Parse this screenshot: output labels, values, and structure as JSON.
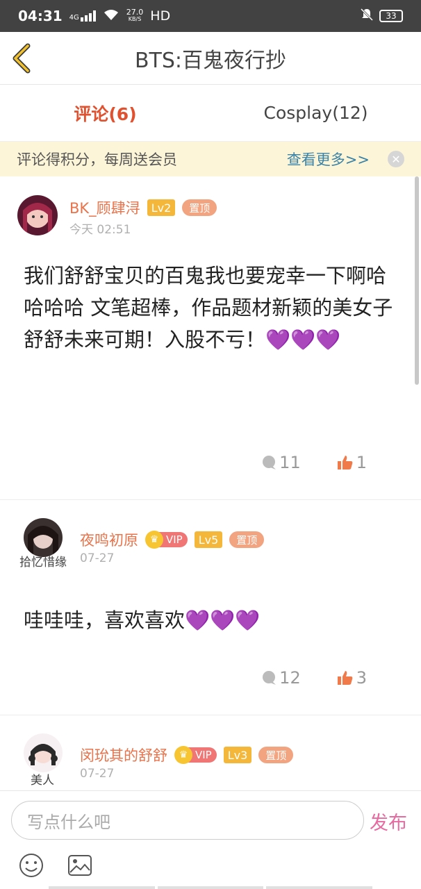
{
  "status_bar": {
    "time": "04:31",
    "network": "4G",
    "speed_value": "27.0",
    "speed_unit": "KB/S",
    "hd": "HD",
    "battery": "33"
  },
  "header": {
    "title": "BTS:百鬼夜行抄"
  },
  "tabs": [
    {
      "label": "评论(6)",
      "active": true
    },
    {
      "label": "Cosplay(12)",
      "active": false
    }
  ],
  "banner": {
    "text": "评论得积分，每周送会员",
    "more": "查看更多>>"
  },
  "comments": [
    {
      "username": "BK_顾肆浔",
      "level": "Lv2",
      "pinned": "置顶",
      "date": "今天 02:51",
      "text": "我们舒舒宝贝的百鬼我也要宠幸一下啊哈哈哈哈   文笔超棒，作品题材新颖的美女子舒舒未来可期！入股不亏！",
      "hearts": "💜💜💜",
      "replies": "11",
      "likes": "1"
    },
    {
      "username": "夜鸣初原",
      "vip": "VIP",
      "level": "Lv5",
      "pinned": "置顶",
      "date": "07-27",
      "tag": "拾忆惜缘",
      "text": "哇哇哇，喜欢喜欢",
      "hearts": "💜💜💜",
      "replies": "12",
      "likes": "3"
    },
    {
      "username": "闵玧其的舒舒",
      "vip": "VIP",
      "level": "Lv3",
      "pinned": "置顶",
      "date": "07-27",
      "tag": "美人"
    }
  ],
  "composer": {
    "placeholder": "写点什么吧",
    "publish": "发布"
  },
  "colors": {
    "accent": "#e0512f",
    "username": "#e9734a",
    "publish": "#e86aa0",
    "banner_bg": "#fdf5d8"
  }
}
